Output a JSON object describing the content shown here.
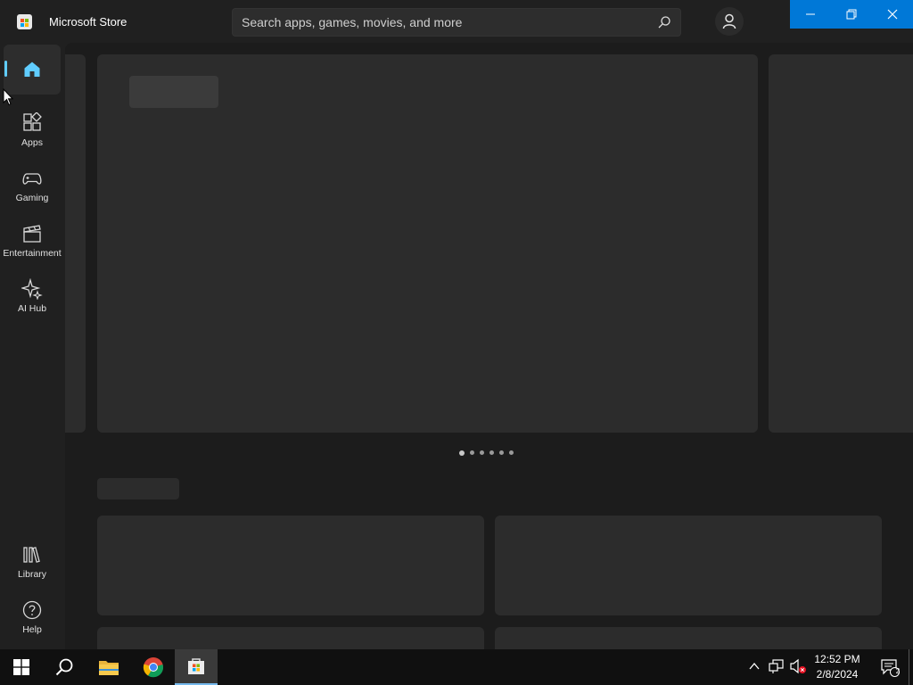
{
  "app": {
    "title": "Microsoft Store"
  },
  "search": {
    "placeholder": "Search apps, games, movies, and more",
    "value": ""
  },
  "window_controls": {
    "minimize": "minimize-icon",
    "restore": "restore-icon",
    "close": "close-icon"
  },
  "sidebar": {
    "items": [
      {
        "label": "",
        "icon": "home-icon",
        "selected": true
      },
      {
        "label": "Apps",
        "icon": "apps-icon"
      },
      {
        "label": "Gaming",
        "icon": "controller-icon"
      },
      {
        "label": "Entertainment",
        "icon": "clapperboard-icon"
      },
      {
        "label": "AI Hub",
        "icon": "sparkle-icon"
      }
    ],
    "bottom_items": [
      {
        "label": "Library",
        "icon": "library-icon"
      },
      {
        "label": "Help",
        "icon": "help-icon"
      }
    ]
  },
  "hero": {
    "slide_count": 6,
    "active_slide": 1
  },
  "taskbar": {
    "apps": [
      "start-icon",
      "search-icon",
      "file-explorer-icon",
      "chrome-icon",
      "microsoft-store-icon"
    ],
    "clock": {
      "time": "12:52 PM",
      "date": "2/8/2024"
    },
    "notifications_count": "2"
  },
  "colors": {
    "accent": "#0078d7",
    "background": "#202020",
    "nav_indicator": "#60cdff"
  }
}
